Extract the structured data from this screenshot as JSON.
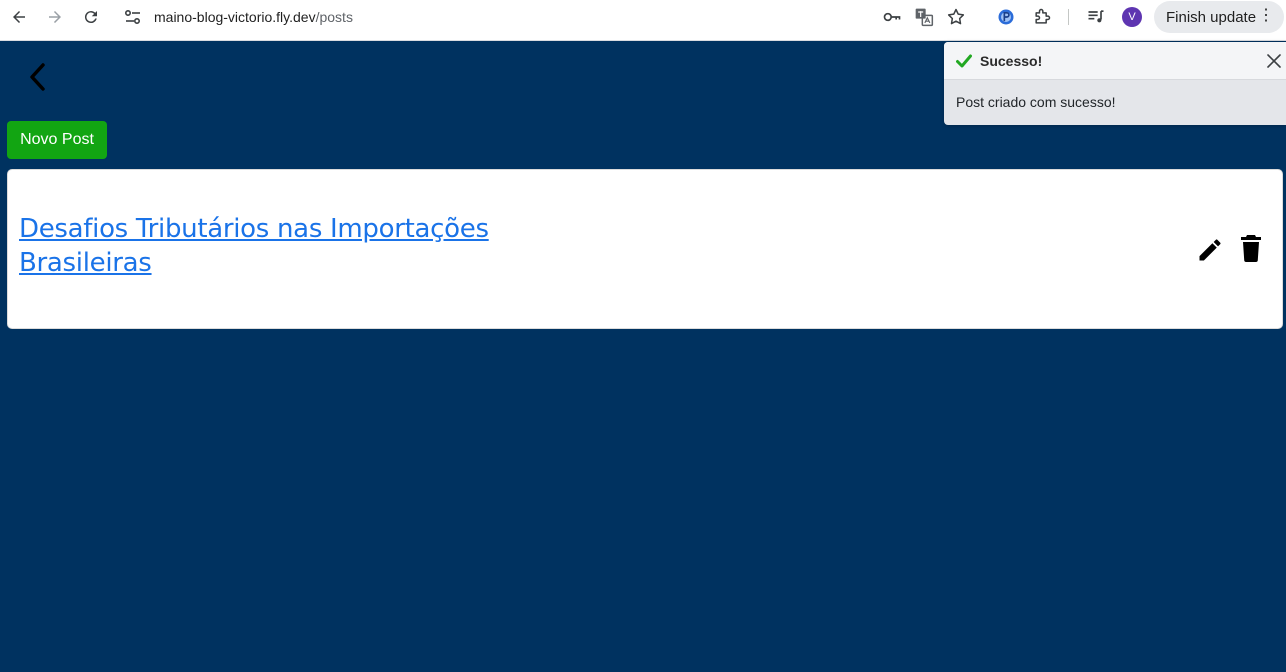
{
  "browser": {
    "url_host": "maino-blog-victorio.fly.dev",
    "url_path": "/posts",
    "avatar_letter": "V",
    "finish_update_label": "Finish update",
    "menu_dots": "⋮",
    "icons": [
      "back-icon",
      "forward-icon",
      "reload-icon",
      "site-info-icon",
      "password-key-icon",
      "translate-icon",
      "bookmark-star-icon",
      "extension-p-icon",
      "extensions-puzzle-icon",
      "media-queue-icon",
      "more-menu-icon"
    ]
  },
  "page": {
    "back_icon": "chevron-left-icon",
    "new_post_label": "Novo Post",
    "posts": [
      {
        "title": "Desafios Tributários nas Importações Brasileiras"
      }
    ]
  },
  "toast": {
    "title": "Sucesso!",
    "message": "Post criado com sucesso!",
    "check_color": "#22a822"
  },
  "colors": {
    "background": "#003260",
    "new_post_button": "#12a512",
    "link": "#1a73e8"
  }
}
